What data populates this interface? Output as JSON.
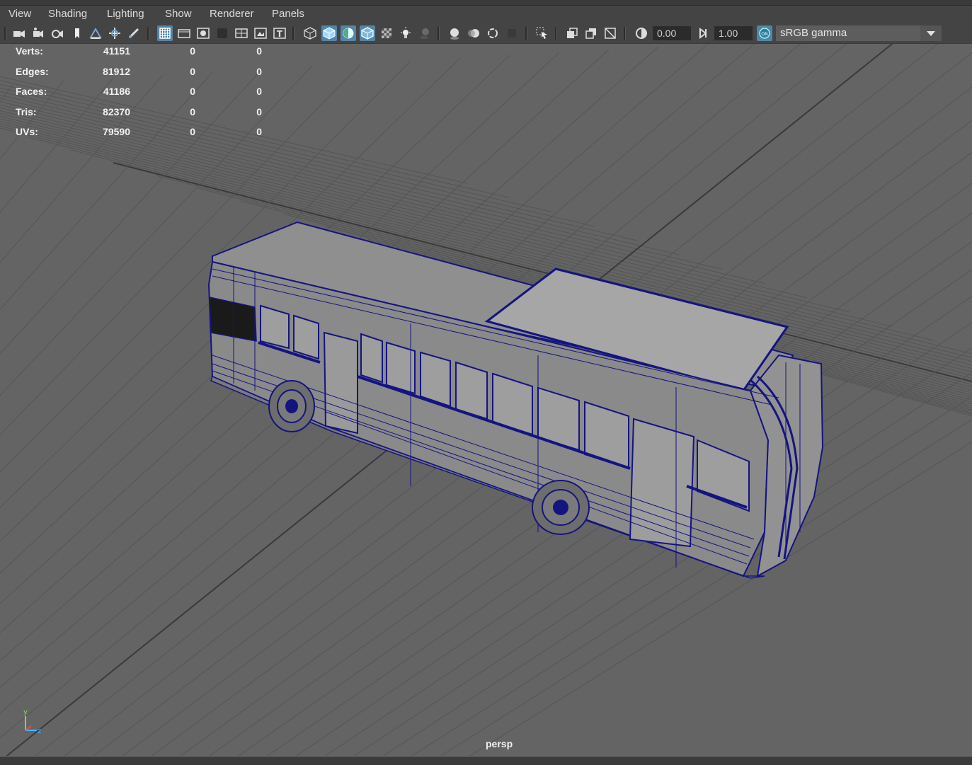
{
  "menu": {
    "view": "View",
    "shading": "Shading",
    "lighting": "Lighting",
    "show": "Show",
    "renderer": "Renderer",
    "panels": "Panels"
  },
  "toolbar": {
    "exposure_value": "0.00",
    "gamma_value": "1.00",
    "color_space": "sRGB gamma",
    "icons": [
      "camera-icon",
      "camera-attributes-icon",
      "camera-lock-icon",
      "bookmark-icon",
      "image-plane-icon",
      "pan-zoom-icon",
      "grease-pencil-icon",
      "grid-icon",
      "film-gate-icon",
      "resolution-gate-icon",
      "gate-mask-icon",
      "field-chart-icon",
      "safe-action-icon",
      "safe-title-icon",
      "wireframe-icon",
      "smooth-shade-icon",
      "default-material-icon",
      "wireframe-on-shaded-icon",
      "textured-icon",
      "lights-icon",
      "shadows-icon",
      "screen-space-ao-icon",
      "motion-blur-icon",
      "anti-aliasing-icon",
      "depth-of-field-icon",
      "isolate-select-icon",
      "xray-icon",
      "xray-active-icon",
      "xray-joints-icon",
      "exposure-icon",
      "gamma-icon",
      "color-management-icon"
    ]
  },
  "colors": {
    "viewport_bg": "#646464",
    "grid_line": "#555555",
    "grid_axis": "#3a3a3a",
    "mesh_fill": "#8d8d8d",
    "wire": "#141480",
    "active_icon": "#5285a6"
  },
  "hud": {
    "verts": {
      "label": "Verts:",
      "total": "41151",
      "selected": "0",
      "components": "0"
    },
    "edges": {
      "label": "Edges:",
      "total": "81912",
      "selected": "0",
      "components": "0"
    },
    "faces": {
      "label": "Faces:",
      "total": "41186",
      "selected": "0",
      "components": "0"
    },
    "tris": {
      "label": "Tris:",
      "total": "82370",
      "selected": "0",
      "components": "0"
    },
    "uvs": {
      "label": "UVs:",
      "total": "79590",
      "selected": "0",
      "components": "0"
    }
  },
  "viewport": {
    "camera": "persp",
    "axes": {
      "y": "y",
      "z": "z"
    }
  }
}
